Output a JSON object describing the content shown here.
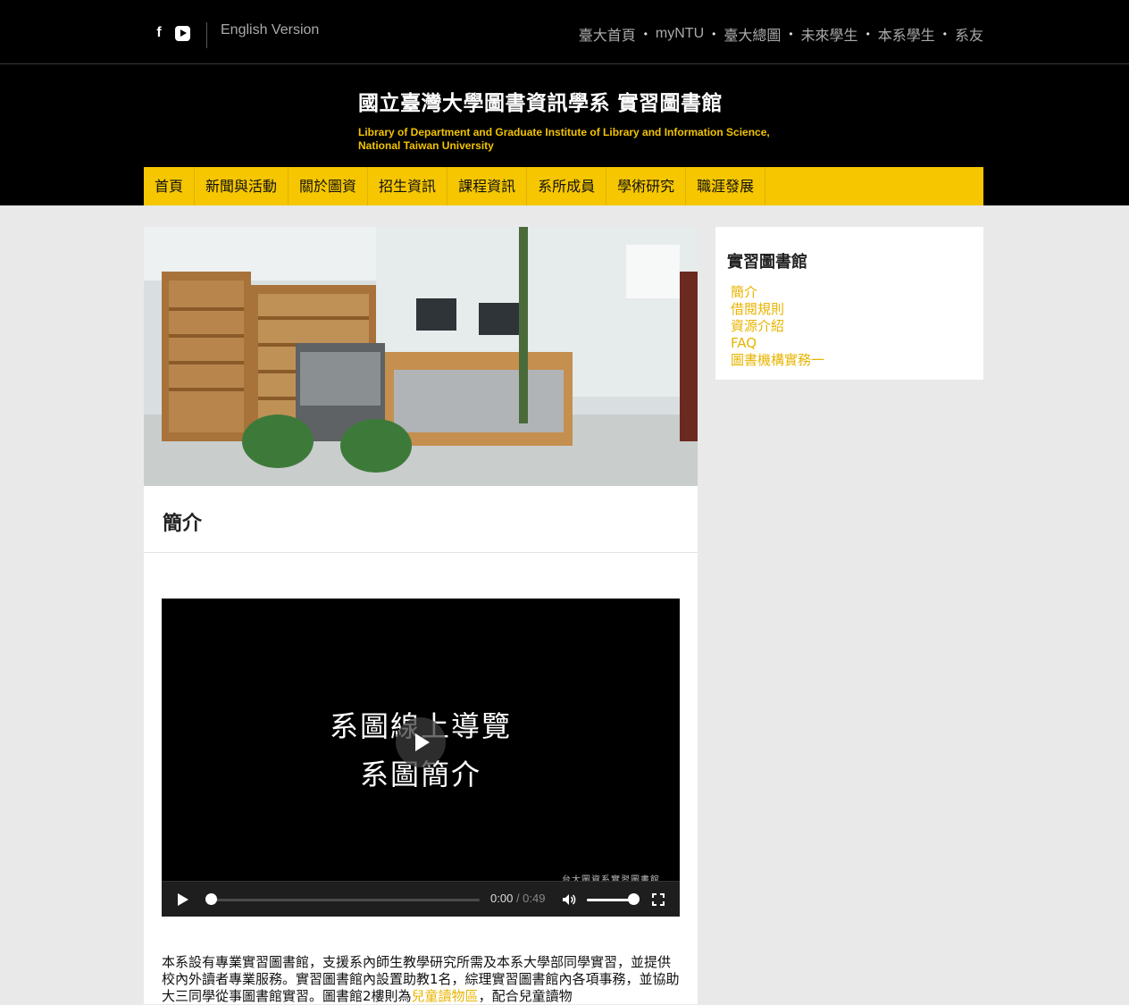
{
  "topbar": {
    "social_facebook": "f",
    "english_version": "English Version",
    "links": [
      "臺大首頁",
      "myNTU",
      "臺大總圖",
      "未來學生",
      "本系學生",
      "系友"
    ],
    "separator": "•"
  },
  "header": {
    "title": "國立臺灣大學圖書資訊學系 實習圖書館",
    "subtitle": "Library of Department and Graduate Institute of Library and Information Science, National Taiwan University"
  },
  "nav": {
    "items": [
      "首頁",
      "新聞與活動",
      "關於圖資",
      "招生資訊",
      "課程資訊",
      "系所成員",
      "學術研究",
      "職涯發展"
    ]
  },
  "main": {
    "page_title": "簡介",
    "video": {
      "title_line1": "系圖線上導覽",
      "title_line2": "系圖簡介",
      "watermark": "台大圖資系實習圖書館",
      "current_time": "0:00",
      "duration": "/ 0:49",
      "progress": 0,
      "volume": 1.0
    },
    "body_before_link": "本系設有專業實習圖書館，支援系內師生教學研究所需及本系大學部同學實習，並提供校內外讀者專業服務。實習圖書館內設置助教1名，綜理實習圖書館內各項事務，並協助大三同學從事圖書館實習。圖書館2樓則為",
    "body_link": "兒童讀物區",
    "body_after_link": "，配合兒童讀物"
  },
  "sidebar": {
    "title": "實習圖書館",
    "items": [
      "簡介",
      "借閱規則",
      "資源介紹",
      "FAQ",
      "圖書機構實務一"
    ]
  },
  "colors": {
    "accent_yellow": "#f6c700",
    "link_yellow": "#e8b400",
    "header_bg": "#000000",
    "page_bg": "#e9e9e9"
  }
}
